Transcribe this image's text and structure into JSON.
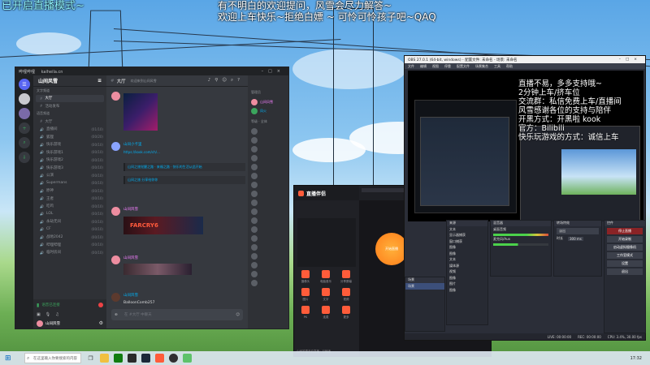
{
  "overlay": {
    "left_title": "已开启直播模式~",
    "top_line1": "有不明白的欢迎提问，风雪会尽力解答~",
    "top_line2": "欢迎上车快乐~拒绝白嫖 ~ 可怜可怜孩子吧~QAQ"
  },
  "discord": {
    "window_title": "哔哩哔哩",
    "window_url": "kaiheila.cn",
    "server_name": "山间风雪",
    "channels": [
      {
        "label": "文字频道",
        "category": true
      },
      {
        "label": "大厅",
        "active": true
      },
      {
        "label": "活动发布"
      },
      {
        "label": "语音频道",
        "category": true
      },
      {
        "label": "大厅"
      },
      {
        "label": "直播间",
        "count": "(01/10)"
      },
      {
        "label": "狐狸",
        "count": "(00/20)"
      },
      {
        "label": "快乐游戏",
        "count": "(00/10)"
      },
      {
        "label": "快乐游戏1",
        "count": "(00/10)"
      },
      {
        "label": "快乐游戏2",
        "count": "(00/10)"
      },
      {
        "label": "快乐游戏3",
        "count": "(00/10)"
      },
      {
        "label": "公演",
        "count": "(00/10)"
      },
      {
        "label": "Supermans",
        "count": "(00/10)"
      },
      {
        "label": "原神",
        "count": "(00/10)"
      },
      {
        "label": "王者",
        "count": "(00/10)"
      },
      {
        "label": "吃鸡",
        "count": "(00/10)"
      },
      {
        "label": "LOL",
        "count": "(00/10)"
      },
      {
        "label": "永劫无间",
        "count": "(00/10)"
      },
      {
        "label": "CF",
        "count": "(00/10)"
      },
      {
        "label": "战地2042",
        "count": "(00/10)"
      },
      {
        "label": "哔哩哔哩",
        "count": "(00/10)"
      },
      {
        "label": "临时房间",
        "count": "(00/10)"
      }
    ],
    "voice_status": "语音已连接",
    "user_name": "山间风雪",
    "channel_header": "大厅",
    "header_topic": "欢迎来到山间风雪",
    "messages": [
      {
        "author": "山间小卡里",
        "link": "https://kook.com/ch/…"
      },
      {
        "author": "山间风雪",
        "embed1": "山间之旅觉醒之路 · 来福之路 · 快乐的生活从此开始",
        "embed2": "山间之旅 分享给你你"
      },
      {
        "author": "山间风雪",
        "image_text": "FARCRY6"
      },
      {
        "author": "山间风雪"
      },
      {
        "author": "山间风雪",
        "text": "BalloonComb257"
      }
    ],
    "input_placeholder": "在 #大厅 中聊天",
    "members_header": "管理员",
    "members": [
      "山间风雪",
      "凤火",
      "魔法 · 白眉"
    ],
    "member_group2": "等级 · 全体"
  },
  "live": {
    "app_name": "直播伴侣",
    "tiles": [
      "摄像头",
      "电脑音乐",
      "分享屏幕",
      "图片",
      "文字",
      "视频",
      "PK",
      "连麦",
      "更多"
    ],
    "bottom_text": "山间风雪开启直播 · 已就绪",
    "start_label": "开始直播"
  },
  "obs": {
    "window_title": "OBS 27.0.1 (64-bit, windows) - 配置文件: 未命名 - 场景: 未命名",
    "menu": [
      "文件",
      "编辑",
      "视图",
      "停靠",
      "配置文件",
      "场景集合",
      "工具",
      "帮助"
    ],
    "overlay_lines": [
      "直播不易，多多支持哦~",
      "2分钟上车/挤车位",
      "交流群：私信免费上车/直播间",
      "风雪感谢各位的支持与陪伴",
      "开黑方式：开黑啦 kook",
      "官方：Bilibili",
      "快乐玩游戏的方式：诚信上车"
    ],
    "docks": {
      "scenes": {
        "title": "场景",
        "items": [
          "场景"
        ]
      },
      "sources": {
        "title": "来源",
        "items": [
          "文本",
          "显示器捕获",
          "窗口捕获",
          "图像",
          "图像",
          "文本",
          "媒体源",
          "视频",
          "图像",
          "图片",
          "图像"
        ]
      },
      "mixer": {
        "title": "混音器",
        "channels": [
          "桌面音频",
          "麦克风/Aux"
        ]
      },
      "transitions": {
        "title": "转场特效",
        "items": [
          "淡出",
          "时长"
        ],
        "duration": "300 ms"
      },
      "controls": {
        "title": "控件",
        "buttons": [
          "停止直播",
          "开始录制",
          "启动虚拟摄像机",
          "工作室模式",
          "设置",
          "退出"
        ]
      }
    },
    "status": [
      "LIVE: 00:00:00",
      "REC: 00:00:00",
      "CPU: 3.4%, 30.00 fps"
    ]
  },
  "taskbar": {
    "search_placeholder": "在这里输入你要搜索的内容",
    "time": "17:32"
  }
}
